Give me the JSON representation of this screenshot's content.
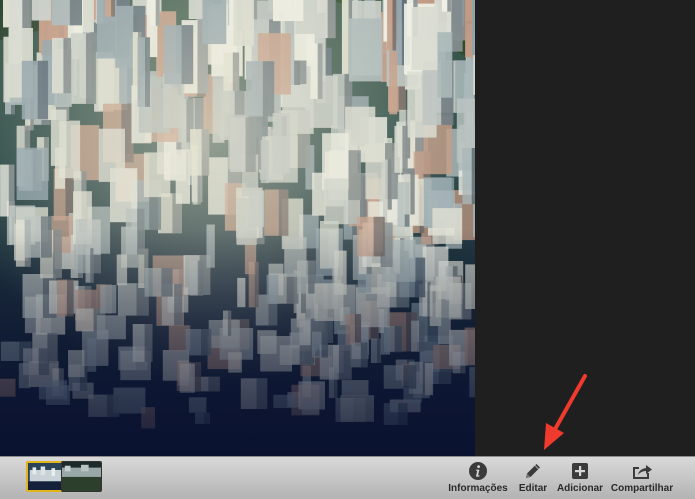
{
  "toolbar": {
    "buttons": [
      {
        "id": "info",
        "label": "Informações",
        "icon": "info-icon"
      },
      {
        "id": "edit",
        "label": "Editar",
        "icon": "pencil-icon"
      },
      {
        "id": "add",
        "label": "Adicionar",
        "icon": "plus-box-icon"
      },
      {
        "id": "share",
        "label": "Compartilhar",
        "icon": "share-icon"
      }
    ],
    "thumbnails": [
      {
        "selected": true
      },
      {
        "selected": false
      }
    ]
  },
  "colors": {
    "annotation_arrow": "#f03a2e",
    "thumbnail_selection": "#e3b51c",
    "toolbar_icon": "#3a3a3a"
  }
}
